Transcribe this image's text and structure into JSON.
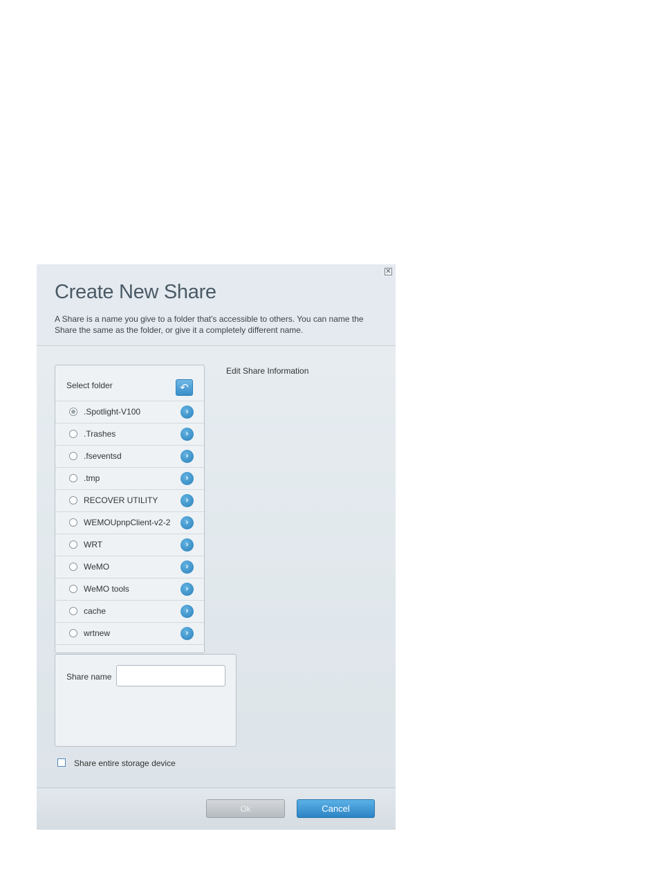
{
  "dialog": {
    "title": "Create New Share",
    "description": "A Share is a name you give to a folder that's accessible to others. You can name the Share the same as the folder, or give it a completely different name.",
    "close_glyph": "✕"
  },
  "folder_panel": {
    "label": "Select folder",
    "back_glyph": "↶",
    "chevron_glyph": "›",
    "folders": [
      {
        "name": ".Spotlight-V100",
        "selected": true
      },
      {
        "name": ".Trashes",
        "selected": false
      },
      {
        "name": ".fseventsd",
        "selected": false
      },
      {
        "name": ".tmp",
        "selected": false
      },
      {
        "name": "RECOVER UTILITY",
        "selected": false
      },
      {
        "name": "WEMOUpnpClient-v2-2",
        "selected": false
      },
      {
        "name": "WRT",
        "selected": false
      },
      {
        "name": "WeMO",
        "selected": false
      },
      {
        "name": "WeMO tools",
        "selected": false
      },
      {
        "name": "cache",
        "selected": false
      },
      {
        "name": "wrtnew",
        "selected": false
      }
    ]
  },
  "edit_info": {
    "heading": "Edit Share Information"
  },
  "share_form": {
    "name_label": "Share name",
    "name_value": "",
    "entire_device_label": "Share entire storage device",
    "entire_device_checked": false
  },
  "footer": {
    "ok_label": "Ok",
    "cancel_label": "Cancel"
  },
  "colors": {
    "accent": "#2b84c4",
    "title_text": "#4a5a66",
    "disabled_button": "#b5bbc0"
  }
}
